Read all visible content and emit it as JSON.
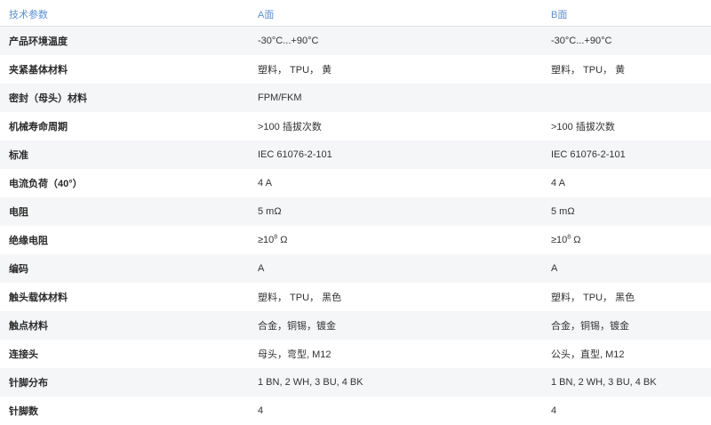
{
  "table": {
    "headers": [
      "技术参数",
      "A面",
      "B面"
    ],
    "rows": [
      {
        "label": "产品环境温度",
        "a": "-30°C...+90°C",
        "b": "-30°C...+90°C"
      },
      {
        "label": "夹紧基体材料",
        "a": "塑料， TPU， 黄",
        "b": "塑料， TPU， 黄"
      },
      {
        "label": "密封（母头）材料",
        "a": "FPM/FKM",
        "b": ""
      },
      {
        "label": "机械寿命周期",
        "a": ">100 插拔次数",
        "b": ">100 插拔次数"
      },
      {
        "label": "标准",
        "a": "IEC 61076-2-101",
        "b": "IEC 61076-2-101"
      },
      {
        "label": "电流负荷（40°）",
        "a": "4 A",
        "b": "4 A"
      },
      {
        "label": "电阻",
        "a": "5 mΩ",
        "b": "5 mΩ"
      },
      {
        "label": "绝缘电阻",
        "a_base": "≥10",
        "a_exp": "8",
        "a_unit": " Ω",
        "b_base": "≥10",
        "b_exp": "8",
        "b_unit": " Ω"
      },
      {
        "label": "编码",
        "a": "A",
        "b": "A"
      },
      {
        "label": "触头载体材料",
        "a": "塑料， TPU， 黑色",
        "b": "塑料， TPU， 黑色"
      },
      {
        "label": "触点材料",
        "a": "合金，铜锡，镀金",
        "b": "合金，铜锡，镀金"
      },
      {
        "label": "连接头",
        "a": "母头，弯型, M12",
        "b": "公头，直型, M12"
      },
      {
        "label": "针脚分布",
        "a": "1 BN, 2 WH, 3 BU, 4 BK",
        "b": "1 BN, 2 WH, 3 BU, 4 BK"
      },
      {
        "label": "针脚数",
        "a": "4",
        "b": "4"
      }
    ]
  }
}
